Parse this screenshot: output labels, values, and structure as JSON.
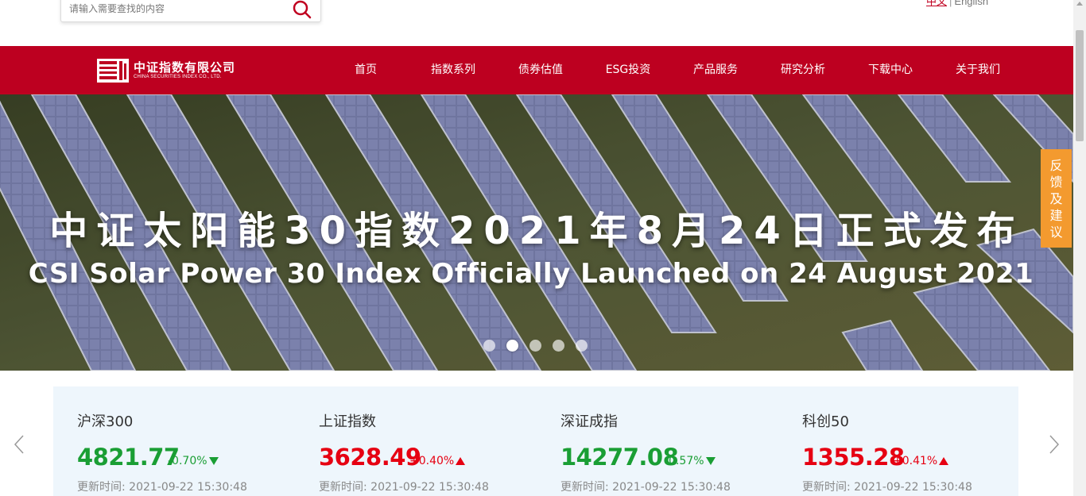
{
  "search": {
    "placeholder": "请输入需要查找的内容"
  },
  "language": {
    "chinese": "中文",
    "separator": "|",
    "english": "English"
  },
  "logo": {
    "name_cn": "中证指数有限公司",
    "name_en": "CHINA SECURITIES INDEX CO., LTD."
  },
  "nav": {
    "items": [
      {
        "label": "首页"
      },
      {
        "label": "指数系列"
      },
      {
        "label": "债券估值"
      },
      {
        "label": "ESG投资"
      },
      {
        "label": "产品服务"
      },
      {
        "label": "研究分析"
      },
      {
        "label": "下载中心"
      },
      {
        "label": "关于我们"
      }
    ]
  },
  "banner": {
    "title_cn": "中证太阳能30指数2021年8月24日正式发布",
    "title_en": "CSI Solar Power 30 Index Officially Launched on 24 August 2021",
    "slide_count": 5,
    "active_slide": 2
  },
  "feedback": {
    "chars": [
      "反",
      "馈",
      "及",
      "建",
      "议"
    ]
  },
  "indices": [
    {
      "name": "沪深300",
      "value": "4821.77",
      "change": "-0.70%",
      "direction": "down",
      "update_label": "更新时间:",
      "update_time": "2021-09-22 15:30:48"
    },
    {
      "name": "上证指数",
      "value": "3628.49",
      "change": "+0.40%",
      "direction": "up",
      "update_label": "更新时间:",
      "update_time": "2021-09-22 15:30:48"
    },
    {
      "name": "深证成指",
      "value": "14277.08",
      "change": "-0.57%",
      "direction": "down",
      "update_label": "更新时间:",
      "update_time": "2021-09-22 15:30:48"
    },
    {
      "name": "科创50",
      "value": "1355.28",
      "change": "+0.41%",
      "direction": "up",
      "update_label": "更新时间:",
      "update_time": "2021-09-22 15:30:48"
    }
  ],
  "colors": {
    "brand_red": "#bd0020",
    "up": "#e60012",
    "down": "#1a9e34",
    "feedback": "#f39a2f",
    "panel_bg": "#eef6fc"
  }
}
